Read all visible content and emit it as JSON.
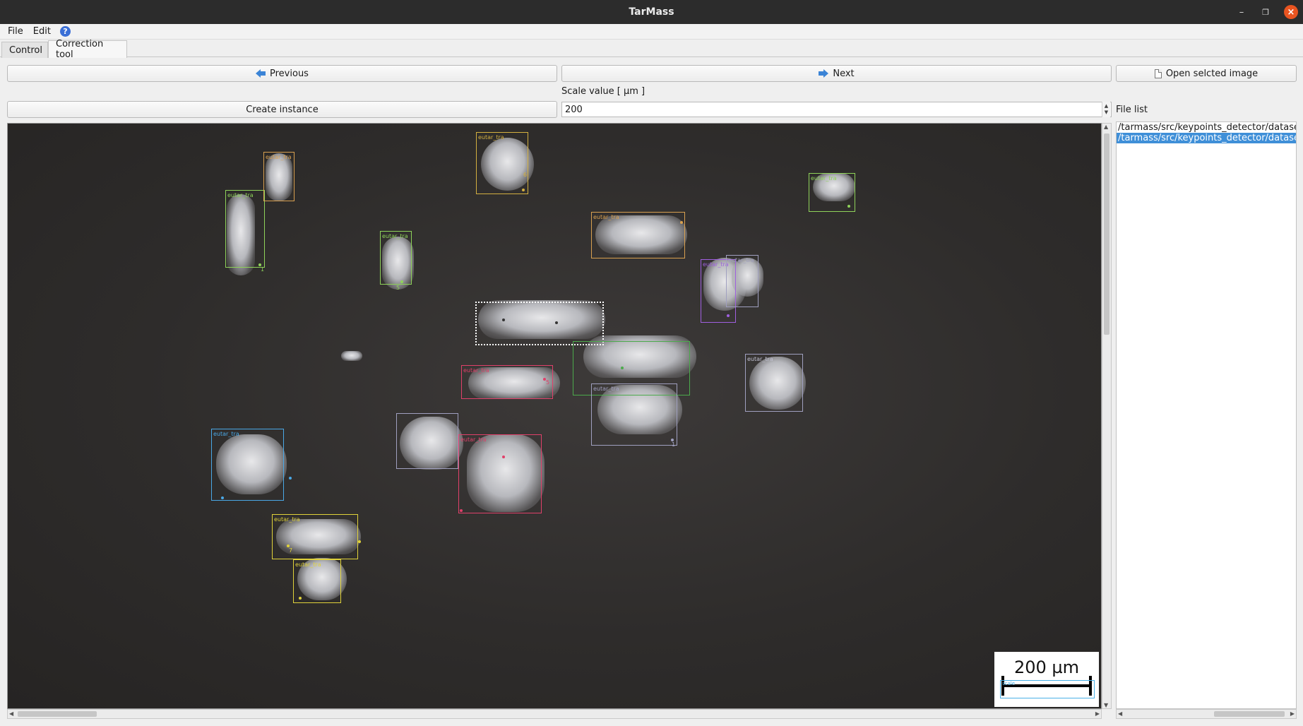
{
  "window": {
    "title": "TarMass"
  },
  "menu": {
    "file": "File",
    "edit": "Edit",
    "help": "?"
  },
  "tabs": [
    {
      "label": "Control"
    },
    {
      "label": "Correction tool"
    }
  ],
  "toolbar": {
    "previous": "Previous",
    "next": "Next",
    "open_selected": "Open selcted image",
    "create_instance": "Create instance",
    "scale_label": "Scale value [ µm ]",
    "scale_value": "200",
    "file_list_label": "File list"
  },
  "image": {
    "scale_bar_text": "200 µm",
    "scale_bar_label": "scale",
    "instance_label": "eutar_tra",
    "keypoint_numbers": [
      "1",
      "5",
      "6",
      "7"
    ]
  },
  "files": [
    {
      "path": "/tarmass/src/keypoints_detector/datasets/",
      "selected": false
    },
    {
      "path": "/tarmass/src/keypoints_detector/datasets/",
      "selected": true
    }
  ],
  "colors": {
    "accent": "#3f8fd8",
    "close": "#e95420",
    "box_green": "#8fd35a",
    "box_yellow": "#e0d23a",
    "box_orange": "#d8a050",
    "box_pink": "#e0406a",
    "box_purple": "#a060e0",
    "box_blue": "#4aa8e6",
    "box_gray": "#a0a0c0"
  }
}
